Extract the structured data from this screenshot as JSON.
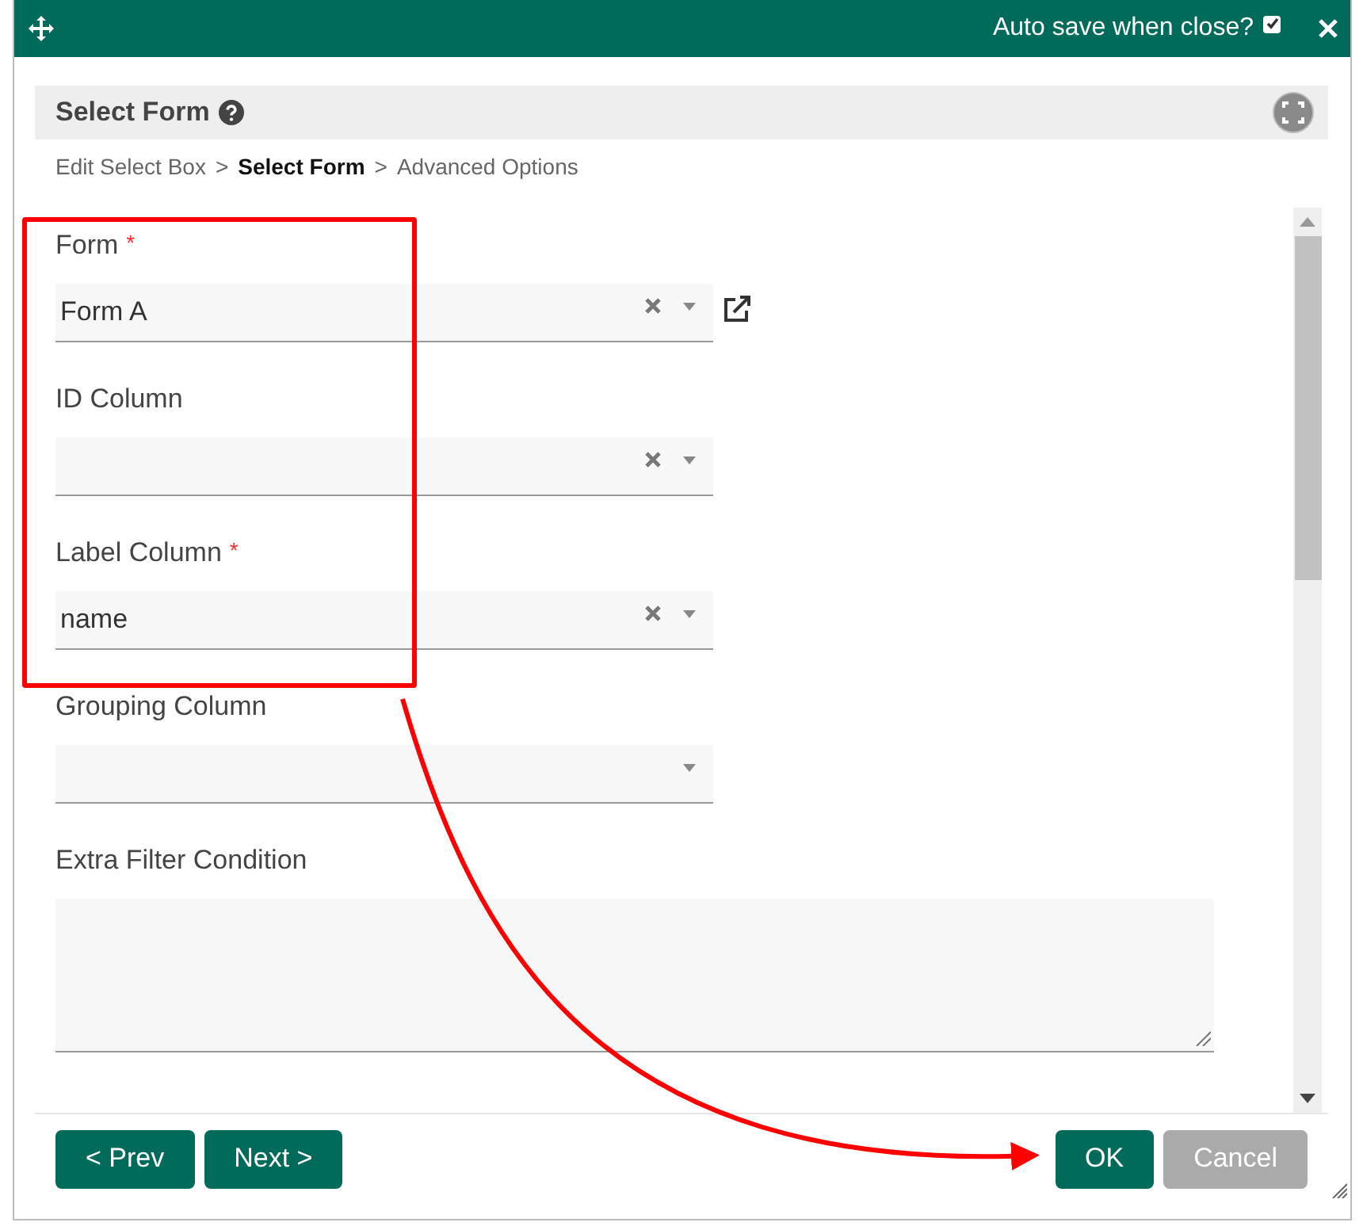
{
  "header": {
    "auto_save_label": "Auto save when close?",
    "auto_save_checked": true
  },
  "panel": {
    "title": "Select Form"
  },
  "breadcrumb": [
    {
      "kind": "crumb",
      "label": "Edit Select Box",
      "selected": false
    },
    {
      "kind": "separator",
      "label": ">"
    },
    {
      "kind": "crumb",
      "label": "Select Form",
      "selected": true
    },
    {
      "kind": "separator",
      "label": ">"
    },
    {
      "kind": "crumb",
      "label": "Advanced Options",
      "selected": false
    }
  ],
  "fields": [
    {
      "kind": "select",
      "label": "Form",
      "required_mark": "*",
      "value": "Form A",
      "clearable": true,
      "open_link": true
    },
    {
      "kind": "select",
      "label": "ID Column",
      "clearable": true
    },
    {
      "kind": "select",
      "label": "Label Column",
      "required_mark": "*",
      "value": "name",
      "clearable": true
    },
    {
      "kind": "select",
      "label": "Grouping Column",
      "clearable": false
    },
    {
      "kind": "textarea",
      "label": "Extra Filter Condition"
    }
  ],
  "nav_buttons": [
    {
      "label": "< Prev",
      "disabled": false
    },
    {
      "label": "Next >",
      "disabled": false
    }
  ],
  "action_buttons": [
    {
      "label": "OK",
      "disabled": false
    },
    {
      "label": "Cancel",
      "disabled": true
    }
  ]
}
